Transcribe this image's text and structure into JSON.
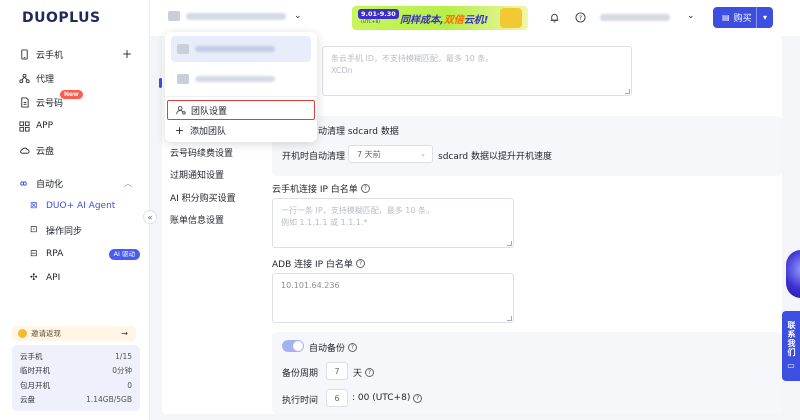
{
  "sidebar": {
    "logo": "DUOPLUS",
    "items": [
      {
        "label": "云手机",
        "icon": "phone-icon"
      },
      {
        "label": "代理",
        "icon": "proxy-icon"
      },
      {
        "label": "云号码",
        "icon": "sim-icon",
        "badge": "New"
      },
      {
        "label": "APP",
        "icon": "apps-icon"
      },
      {
        "label": "云盘",
        "icon": "cloud-icon"
      }
    ],
    "automation": {
      "label": "自动化",
      "sub": [
        {
          "label": "DUO+ AI Agent"
        },
        {
          "label": "操作同步"
        },
        {
          "label": "RPA",
          "badge": "AI 驱动"
        },
        {
          "label": "API"
        }
      ]
    },
    "promo": {
      "label": "邀请返现",
      "arrow": "→"
    },
    "usage": [
      {
        "label": "云手机",
        "value": "1/15"
      },
      {
        "label": "临时开机",
        "value": "0分钟"
      },
      {
        "label": "包月开机",
        "value": "0"
      },
      {
        "label": "云盘",
        "value": "1.14GB/5GB"
      }
    ]
  },
  "topbar": {
    "banner": {
      "date": "9.01-9.30",
      "tz": "(UTC+8)",
      "text1": "同样成本,",
      "text2": "双倍",
      "text3": "云机!"
    },
    "buy_label": "购买",
    "buy_more": "▾"
  },
  "dropdown": {
    "team_settings": "团队设置",
    "add_team": "添加团队"
  },
  "left_menu": [
    {
      "label": "云号码续费设置"
    },
    {
      "label": "过期通知设置"
    },
    {
      "label": "AI 积分购买设置"
    },
    {
      "label": "账单信息设置"
    }
  ],
  "content": {
    "top_textarea_placeholder_line1": "条云手机 ID，不支持模糊匹配，最多 10 条。",
    "top_textarea_placeholder_line2": "XCDn",
    "sd_title": "动清理 sdcard 数据",
    "sd_row_label": "开机时自动清理",
    "sd_select": "7 天前",
    "sd_suffix": "sdcard 数据以提升开机速度",
    "ip_whitelist_label": "云手机连接 IP 白名单",
    "ip_placeholder_line1": "一行一条 IP，支持模糊匹配，最多 10 条。",
    "ip_placeholder_line2": "例如 1.1.1.1 或 1.1.1.*",
    "adb_label": "ADB 连接 IP 白名单",
    "adb_value": "10.101.64.236",
    "backup_label": "自动备份",
    "backup_cycle_label": "备份周期",
    "backup_cycle_value": "7",
    "backup_cycle_unit": "天",
    "exec_time_label": "执行时间",
    "exec_time_value": "6",
    "exec_time_suffix": ": 00  (UTC+8)"
  },
  "contact": {
    "label": "联系我们"
  }
}
